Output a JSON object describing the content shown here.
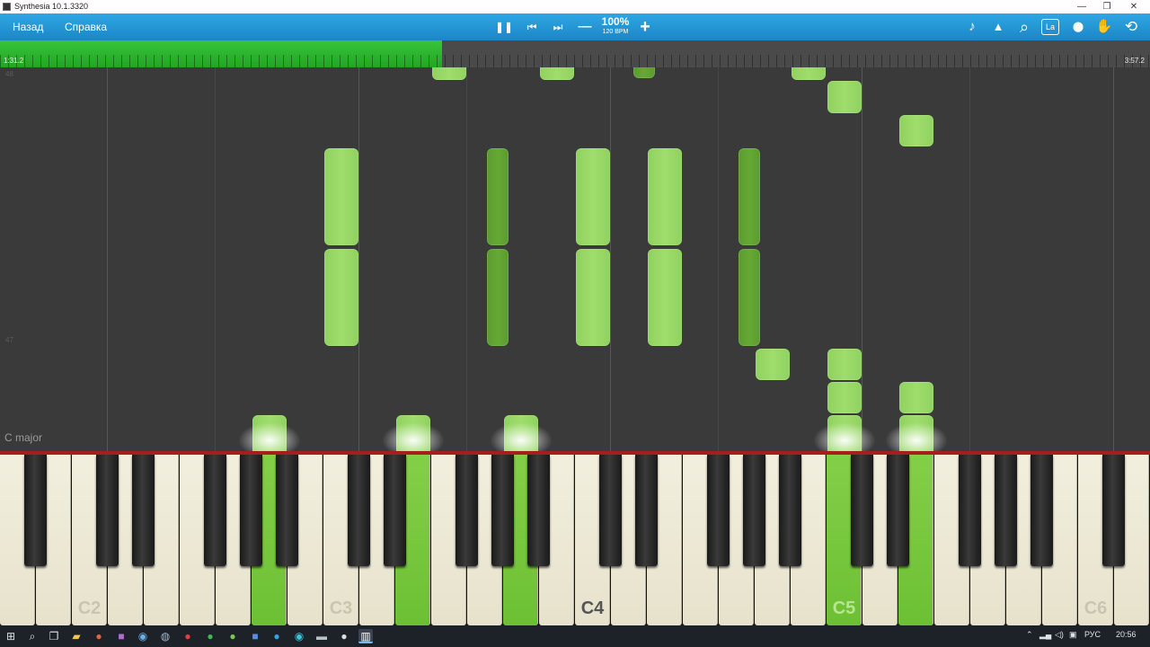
{
  "window": {
    "title": "Synthesia 10.1.3320",
    "minimize": "—",
    "restore": "❐",
    "close": "✕"
  },
  "toolbar": {
    "back_label": "Назад",
    "help_label": "Справка",
    "pause_icon": "❚❚",
    "prev_icon": "⏮",
    "next_icon": "⏭",
    "slower_icon": "—",
    "faster_icon": "+",
    "speed": "100%",
    "bpm": "120 BPM",
    "right_icons": [
      {
        "name": "music-note-icon",
        "glyph": "♪"
      },
      {
        "name": "metronome-icon",
        "glyph": "▲"
      },
      {
        "name": "magnifier-icon",
        "glyph": "⌕"
      },
      {
        "name": "note-labels-icon",
        "glyph": "La"
      },
      {
        "name": "location-pin-icon",
        "glyph": "⬤"
      },
      {
        "name": "hand-icon",
        "glyph": "✋"
      },
      {
        "name": "loop-icon",
        "glyph": "⟲"
      }
    ]
  },
  "timeline": {
    "current": "1:31.2",
    "total": "3:57.2",
    "progress": 0.384,
    "color": "#2db530"
  },
  "roll": {
    "measure_top": "48",
    "measure_mid": "47",
    "key_signature": "C major",
    "note_color": "#98d866",
    "dark_note_color": "#62a332"
  },
  "keyboard": {
    "octave_labels": [
      "C2",
      "C3",
      "C4",
      "C5",
      "C6"
    ],
    "pressed_color": "#76c53c",
    "line_color": "#a81e1e"
  },
  "taskbar": {
    "tray_lang": "РУС",
    "clock": "20:56"
  }
}
